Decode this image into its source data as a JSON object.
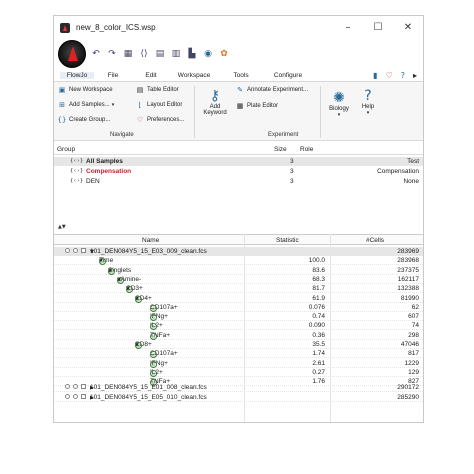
{
  "window": {
    "title": "new_8_color_ICS.wsp"
  },
  "window_controls": {
    "minimize": "–",
    "maximize": "☐",
    "close": "✕"
  },
  "menu": {
    "items": [
      "FlowJo",
      "File",
      "Edit",
      "Workspace",
      "Tools",
      "Configure"
    ],
    "active": "FlowJo"
  },
  "ribbon": {
    "new_workspace": "New Workspace",
    "add_samples": "Add Samples...",
    "create_group": "Create Group...",
    "table_editor": "Table Editor",
    "layout_editor": "Layout Editor",
    "preferences": "Preferences...",
    "navigate_group": "Navigate",
    "add_keyword": [
      "Add",
      "Keyword"
    ],
    "annotate_experiment": "Annotate Experiment...",
    "plate_editor": "Plate Editor",
    "experiment_group": "Experiment",
    "biology": "Biology",
    "help": "Help"
  },
  "groups": {
    "headers": {
      "group": "Group",
      "size": "Size",
      "role": "Role"
    },
    "rows": [
      {
        "icon": "{‹›}",
        "name": "All Samples",
        "size": "3",
        "role": "Test",
        "style": "bold"
      },
      {
        "icon": "{‹›}",
        "name": "Compensation",
        "size": "3",
        "role": "Compensation",
        "style": "red"
      },
      {
        "icon": "{‹›}",
        "name": "DEN",
        "size": "3",
        "role": "None",
        "style": "normal"
      }
    ]
  },
  "samples": {
    "headers": {
      "name": "Name",
      "statistic": "Statistic",
      "cells": "#Cells"
    },
    "rows": [
      {
        "level": 0,
        "type": "sample",
        "name": "101_DEN084Y5_15_E03_009_clean.fcs",
        "statistic": "",
        "cells": "283969",
        "expanded": true
      },
      {
        "level": 1,
        "type": "gate",
        "name": "Time",
        "statistic": "100.0",
        "cells": "283968",
        "expanded": true
      },
      {
        "level": 2,
        "type": "gate",
        "name": "Singlets",
        "statistic": "83.6",
        "cells": "237375",
        "expanded": true
      },
      {
        "level": 3,
        "type": "gate",
        "name": "aAmine-",
        "statistic": "68.3",
        "cells": "162117",
        "expanded": true
      },
      {
        "level": 4,
        "type": "gate",
        "name": "CD3+",
        "statistic": "81.7",
        "cells": "132388",
        "expanded": true
      },
      {
        "level": 5,
        "type": "gate",
        "name": "CD4+",
        "statistic": "61.9",
        "cells": "81990",
        "expanded": true
      },
      {
        "level": 6,
        "type": "gate",
        "name": "CD107a+",
        "statistic": "0.076",
        "cells": "62",
        "expanded": false
      },
      {
        "level": 6,
        "type": "gate",
        "name": "IFNg+",
        "statistic": "0.74",
        "cells": "607",
        "expanded": false
      },
      {
        "level": 6,
        "type": "gate",
        "name": "IL2+",
        "statistic": "0.090",
        "cells": "74",
        "expanded": false
      },
      {
        "level": 6,
        "type": "gate",
        "name": "TNFa+",
        "statistic": "0.36",
        "cells": "298",
        "expanded": false
      },
      {
        "level": 5,
        "type": "gate",
        "name": "CD8+",
        "statistic": "35.5",
        "cells": "47046",
        "expanded": true
      },
      {
        "level": 6,
        "type": "gate",
        "name": "CD107a+",
        "statistic": "1.74",
        "cells": "817",
        "expanded": false
      },
      {
        "level": 6,
        "type": "gate",
        "name": "IFNg+",
        "statistic": "2.61",
        "cells": "1229",
        "expanded": false
      },
      {
        "level": 6,
        "type": "gate",
        "name": "IL2+",
        "statistic": "0.27",
        "cells": "129",
        "expanded": false
      },
      {
        "level": 6,
        "type": "gate",
        "name": "TNFa+",
        "statistic": "1.76",
        "cells": "827",
        "expanded": false
      },
      {
        "level": 0,
        "type": "sample",
        "name": "101_DEN084Y5_15_E01_008_clean.fcs",
        "statistic": "",
        "cells": "290172",
        "expanded": false
      },
      {
        "level": 0,
        "type": "sample",
        "name": "101_DEN084Y5_15_E05_010_clean.fcs",
        "statistic": "",
        "cells": "285290",
        "expanded": false
      }
    ]
  },
  "colors": {
    "compensation": "#c0272d",
    "gate_green": "#3a7a3a",
    "selection": "#e6e6e6"
  }
}
